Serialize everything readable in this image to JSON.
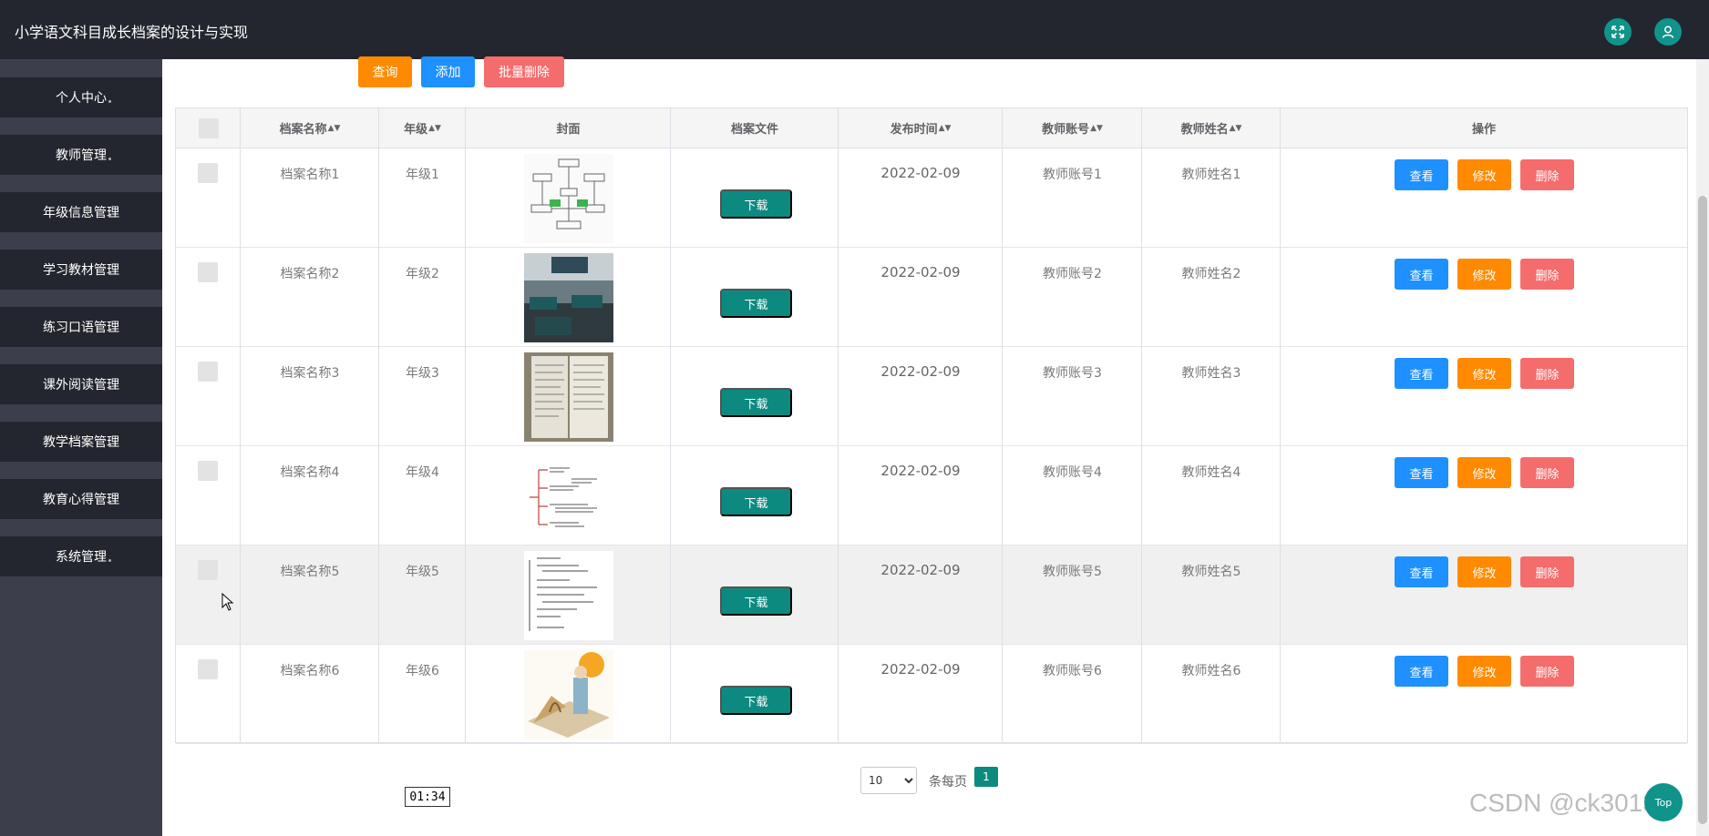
{
  "header": {
    "title": "小学语文科目成长档案的设计与实现"
  },
  "sidebar": {
    "items": [
      {
        "label": "个人中心"
      },
      {
        "label": "教师管理"
      },
      {
        "label": "年级信息管理"
      },
      {
        "label": "学习教材管理"
      },
      {
        "label": "练习口语管理"
      },
      {
        "label": "课外阅读管理"
      },
      {
        "label": "教学档案管理"
      },
      {
        "label": "教育心得管理"
      },
      {
        "label": "系统管理"
      }
    ]
  },
  "toolbar": {
    "query_label": "查询",
    "add_label": "添加",
    "batch_delete_label": "批量删除"
  },
  "table": {
    "columns": {
      "name": "档案名称",
      "grade": "年级",
      "cover": "封面",
      "file": "档案文件",
      "publish_time": "发布时间",
      "teacher_account": "教师账号",
      "teacher_name": "教师姓名",
      "actions": "操作"
    },
    "download_label": "下载",
    "view_label": "查看",
    "edit_label": "修改",
    "delete_label": "删除",
    "rows": [
      {
        "name": "档案名称1",
        "grade": "年级1",
        "time": "2022-02-09",
        "account": "教师账号1",
        "teacher": "教师姓名1",
        "cover": "flowchart-image"
      },
      {
        "name": "档案名称2",
        "grade": "年级2",
        "time": "2022-02-09",
        "account": "教师账号2",
        "teacher": "教师姓名2",
        "cover": "classroom-photo"
      },
      {
        "name": "档案名称3",
        "grade": "年级3",
        "time": "2022-02-09",
        "account": "教师账号3",
        "teacher": "教师姓名3",
        "cover": "notebook-photo"
      },
      {
        "name": "档案名称4",
        "grade": "年级4",
        "time": "2022-02-09",
        "account": "教师账号4",
        "teacher": "教师姓名4",
        "cover": "mindmap-image"
      },
      {
        "name": "档案名称5",
        "grade": "年级5",
        "time": "2022-02-09",
        "account": "教师账号5",
        "teacher": "教师姓名5",
        "cover": "outline-image"
      },
      {
        "name": "档案名称6",
        "grade": "年级6",
        "time": "2022-02-09",
        "account": "教师账号6",
        "teacher": "教师姓名6",
        "cover": "illustration-image"
      }
    ]
  },
  "pagination": {
    "page_size": "10",
    "per_page_label": "条每页",
    "current_page": "1"
  },
  "overlay": {
    "video_time": "01:34",
    "watermark": "CSDN @ck3013",
    "back_to_top": "Top"
  },
  "colors": {
    "topbar": "#23262e",
    "accent": "#0d8a80",
    "blue": "#1e90ff",
    "orange": "#ff8a00",
    "red": "#f56c6c"
  }
}
